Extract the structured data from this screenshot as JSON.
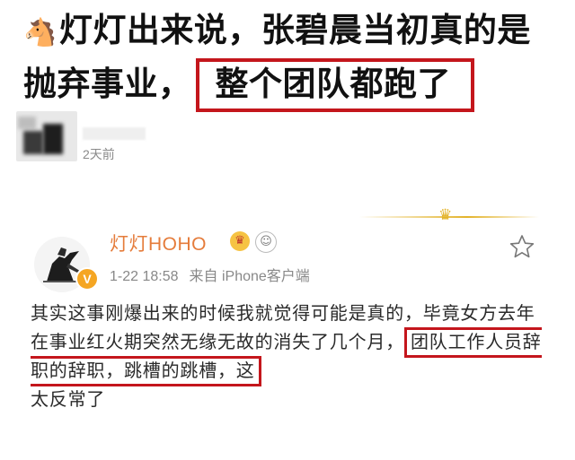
{
  "headline": {
    "icon": "horse-emoji",
    "text_main": "灯灯出来说，张碧晨当初真的是抛弃事业，",
    "text_boxed": "整个团队都跑了"
  },
  "comment": {
    "time": "2天前"
  },
  "post": {
    "user_name": "灯灯HOHO",
    "vip_icon": "crown-icon",
    "fan_icon": "fan-badge-icon",
    "date": "1-22 18:58",
    "source": "来自 iPhone客户端",
    "text_before": "其实这事刚爆出来的时候我就觉得可能是真的，毕竟女方去年在事业红火期突然无缘无故的消失了几个月，",
    "text_boxed": "团队工作人员辞职的辞职，跳槽的跳槽，这",
    "text_after": "太反常了"
  },
  "colors": {
    "highlight_box": "#c4161c",
    "username": "#e57c3b",
    "meta_text": "#888888",
    "gold_decoration": "#e3b32a"
  }
}
